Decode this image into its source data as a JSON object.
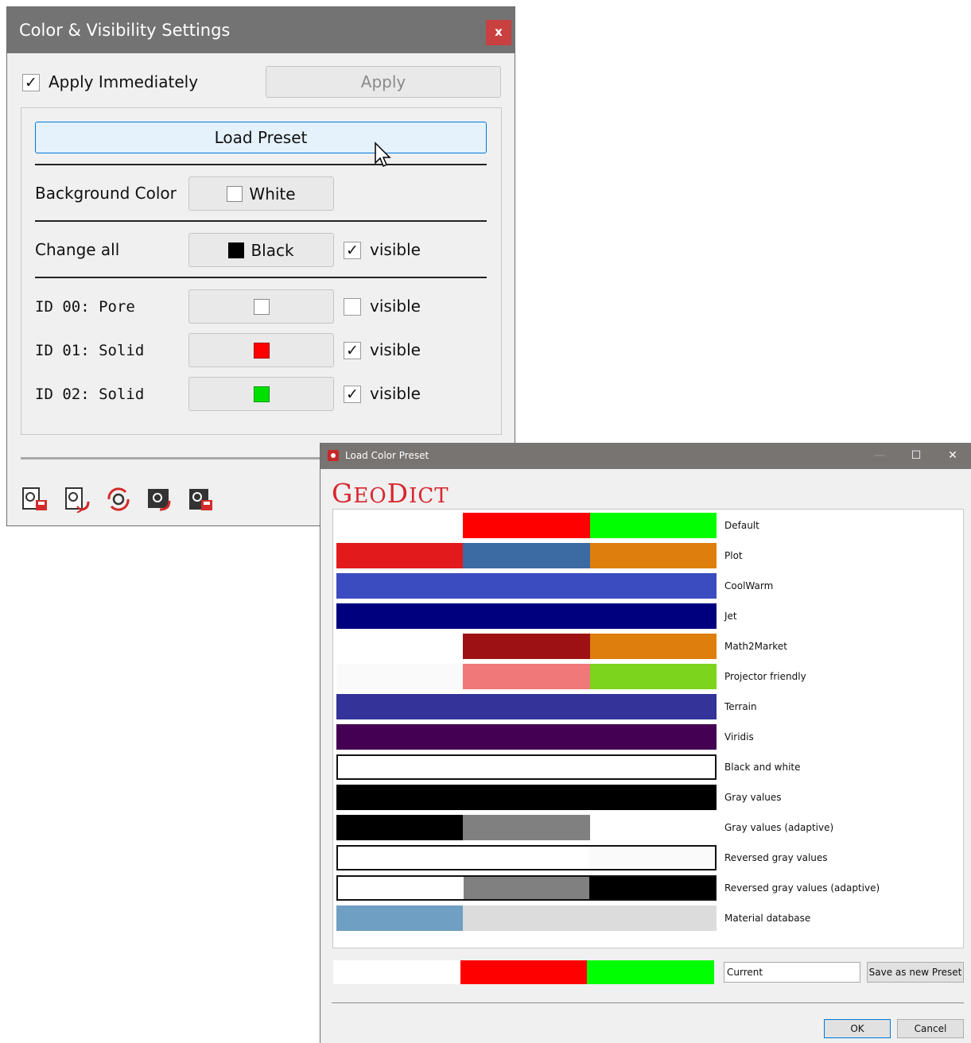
{
  "settings": {
    "title": "Color & Visibility Settings",
    "close_label": "x",
    "apply_immediately": {
      "label": "Apply Immediately",
      "checked": true
    },
    "apply_label": "Apply",
    "load_preset_label": "Load Preset",
    "background": {
      "label": "Background Color",
      "value": "White",
      "color": "#ffffff"
    },
    "change_all": {
      "label": "Change all",
      "value": "Black",
      "color": "#000000",
      "visible_label": "visible",
      "visible": true
    },
    "materials": [
      {
        "label": "ID 00: Pore",
        "color": "#ffffff",
        "visible_label": "visible",
        "visible": false
      },
      {
        "label": "ID 01: Solid",
        "color": "#ff0000",
        "visible_label": "visible",
        "visible": true
      },
      {
        "label": "ID 02: Solid",
        "color": "#00e000",
        "visible_label": "visible",
        "visible": true
      }
    ],
    "toolbar_icons": [
      "save-settings-icon",
      "load-settings-icon",
      "reset-settings-icon",
      "import-settings-icon",
      "export-settings-icon"
    ]
  },
  "preset_dialog": {
    "title": "Load Color Preset",
    "logo_first": "G",
    "logo_mid": "EO",
    "logo_d": "D",
    "logo_rest": "ICT",
    "presets": [
      {
        "name": "Default",
        "colors": [
          "#ffffff",
          "#ff0000",
          "#00ff00"
        ],
        "outlined": false
      },
      {
        "name": "Plot",
        "colors": [
          "#e31a1c",
          "#3c6ba3",
          "#de7e0c"
        ],
        "outlined": false
      },
      {
        "name": "CoolWarm",
        "colors": [
          "#3b4cc0",
          "#3b4cc0",
          "#3b4cc0"
        ],
        "outlined": false
      },
      {
        "name": "Jet",
        "colors": [
          "#00007f",
          "#00007f",
          "#00007f"
        ],
        "outlined": false
      },
      {
        "name": "Math2Market",
        "colors": [
          "#ffffff",
          "#9d1115",
          "#de7e0c"
        ],
        "outlined": false
      },
      {
        "name": "Projector friendly",
        "colors": [
          "#fafafa",
          "#f07878",
          "#7dd41c"
        ],
        "outlined": false
      },
      {
        "name": "Terrain",
        "colors": [
          "#333399",
          "#333399",
          "#333399"
        ],
        "outlined": false
      },
      {
        "name": "Viridis",
        "colors": [
          "#440154",
          "#440154",
          "#440154"
        ],
        "outlined": false
      },
      {
        "name": "Black and white",
        "colors": [
          "#ffffff",
          "#ffffff",
          "#ffffff"
        ],
        "outlined": true
      },
      {
        "name": "Gray values",
        "colors": [
          "#000000",
          "#000000",
          "#000000"
        ],
        "outlined": false
      },
      {
        "name": "Gray values (adaptive)",
        "colors": [
          "#000000",
          "#808080",
          "#ffffff"
        ],
        "outlined": false
      },
      {
        "name": "Reversed gray values",
        "colors": [
          "#ffffff",
          "#ffffff",
          "#fafafa"
        ],
        "outlined": true
      },
      {
        "name": "Reversed gray values (adaptive)",
        "colors": [
          "#ffffff",
          "#808080",
          "#000000"
        ],
        "outlined": true
      },
      {
        "name": "Material database",
        "colors": [
          "#6f9fc3",
          "#dcdcdc",
          "#dcdcdc"
        ],
        "outlined": false
      }
    ],
    "current": {
      "name": "Current",
      "colors": [
        "#ffffff",
        "#ff0000",
        "#00ff00"
      ]
    },
    "save_label": "Save as new Preset",
    "ok_label": "OK",
    "cancel_label": "Cancel"
  }
}
